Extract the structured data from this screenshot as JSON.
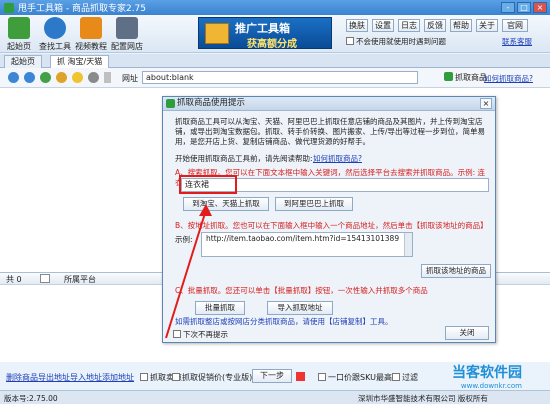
{
  "titlebar": {
    "title": "甩手工具箱 - 商品抓取专家2.75",
    "min": "-",
    "max": "□",
    "close": "×"
  },
  "toolbar": {
    "buttons": [
      {
        "label": "起始页",
        "color": "#3f9d3b"
      },
      {
        "label": "查找工具",
        "color": "#2c78c9"
      },
      {
        "label": "视频教程",
        "color": "#e88a1a"
      },
      {
        "label": "配置网店",
        "color": "#5f6f86"
      }
    ],
    "promo": {
      "line1": "推广工具箱",
      "line2": "获高额分成"
    },
    "right_buttons": [
      "换肤",
      "设置",
      "日志",
      "反馈",
      "帮助",
      "关于",
      "官网"
    ],
    "checkbox_label": "不会使用就使用时遇到问题",
    "right_link": "联系客服"
  },
  "tabs": [
    {
      "label": "起始页",
      "active": false
    },
    {
      "label": "抓 淘宝/天猫",
      "active": true
    }
  ],
  "addressbar": {
    "label": "网址",
    "value": "about:blank",
    "grab_button": "抓取商品",
    "help_link": "如何抓取商品?"
  },
  "grid": {
    "headers": [
      "共 0",
      "",
      "所属平台"
    ]
  },
  "bottom": {
    "links": [
      "删除商品",
      "导出地址",
      "导入地址",
      "添加地址"
    ],
    "checkboxes": [
      "抓取卖点",
      "抓取促销价(专业版)",
      "一口价跟SKU最高价",
      "过滤"
    ],
    "next": "下一步"
  },
  "statusbar": {
    "version": "版本号:2.75.00",
    "right": "深圳市华盛智能技术有限公司 版权所有"
  },
  "dialog": {
    "title": "抓取商品使用提示",
    "close": "×",
    "intro": "抓取商品工具可以从淘宝、天猫、阿里巴巴上抓取任意店铺的商品及其图片，并上传到淘宝店铺，或导出到淘宝数据包。抓取、转手价转换、图片搬家、上传/导出等过程一步到位，简单易用，是您开店上货、复制店铺商品、做代理货源的好帮手。",
    "start_text": "开始使用抓取商品工具前，请先阅读帮助:",
    "start_link": "如何抓取商品?",
    "section_a": "A、搜索抓取。您可以在下面文本框中输入关键词，然后选择平台去搜索并抓取商品。示例: 连衣裙",
    "keyword": "连衣裙",
    "btn_taobao": "到淘宝、天猫上抓取",
    "btn_alibaba": "到阿里巴巴上抓取",
    "section_b": "B、按地址抓取。您也可以在下面输入框中输入一个商品地址，然后单击【抓取该地址的商品】",
    "example_label": "示例:",
    "example_url": "http://item.taobao.com/item.htm?id=15413101389",
    "btn_grab_url": "抓取该地址的商品",
    "section_c": "C、批量抓取。您还可以单击【批量抓取】按钮，一次性输入并抓取多个商品",
    "btn_batch": "批量抓取",
    "btn_import": "导入抓取地址",
    "shop_tip": "如需抓取整店或按网店分类抓取商品，请使用【店铺复制】工具。",
    "no_show": "下次不再提示",
    "btn_close": "关闭"
  },
  "watermark": {
    "line1": "当客软件园",
    "line2": "www.downkr.com"
  }
}
